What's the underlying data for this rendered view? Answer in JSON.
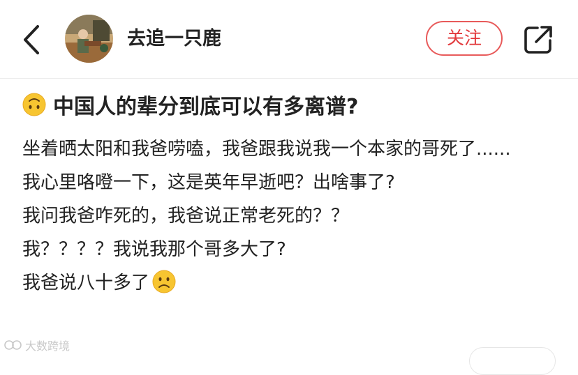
{
  "header": {
    "back_icon": "chevron-left-icon",
    "author_name": "去追一只鹿",
    "follow_label": "关注",
    "share_icon": "share-external-icon"
  },
  "post": {
    "title_emoji": "upside-down-face-emoji",
    "title": "中国人的辈分到底可以有多离谱?",
    "lines": [
      "坐着晒太阳和我爸唠嗑，我爸跟我说我一个本家的哥死了......",
      "我心里咯噔一下，这是英年早逝吧？出啥事了?",
      "我问我爸咋死的，我爸说正常老死的？？",
      "我？？？？我说我那个哥多大了?",
      "我爸说八十多了"
    ],
    "last_line_emoji": "frowning-face-emoji"
  },
  "watermark": {
    "text": "大数跨境"
  },
  "colors": {
    "follow_red": "#e2393c",
    "text": "#222222",
    "emoji_yellow": "#f7c531"
  }
}
